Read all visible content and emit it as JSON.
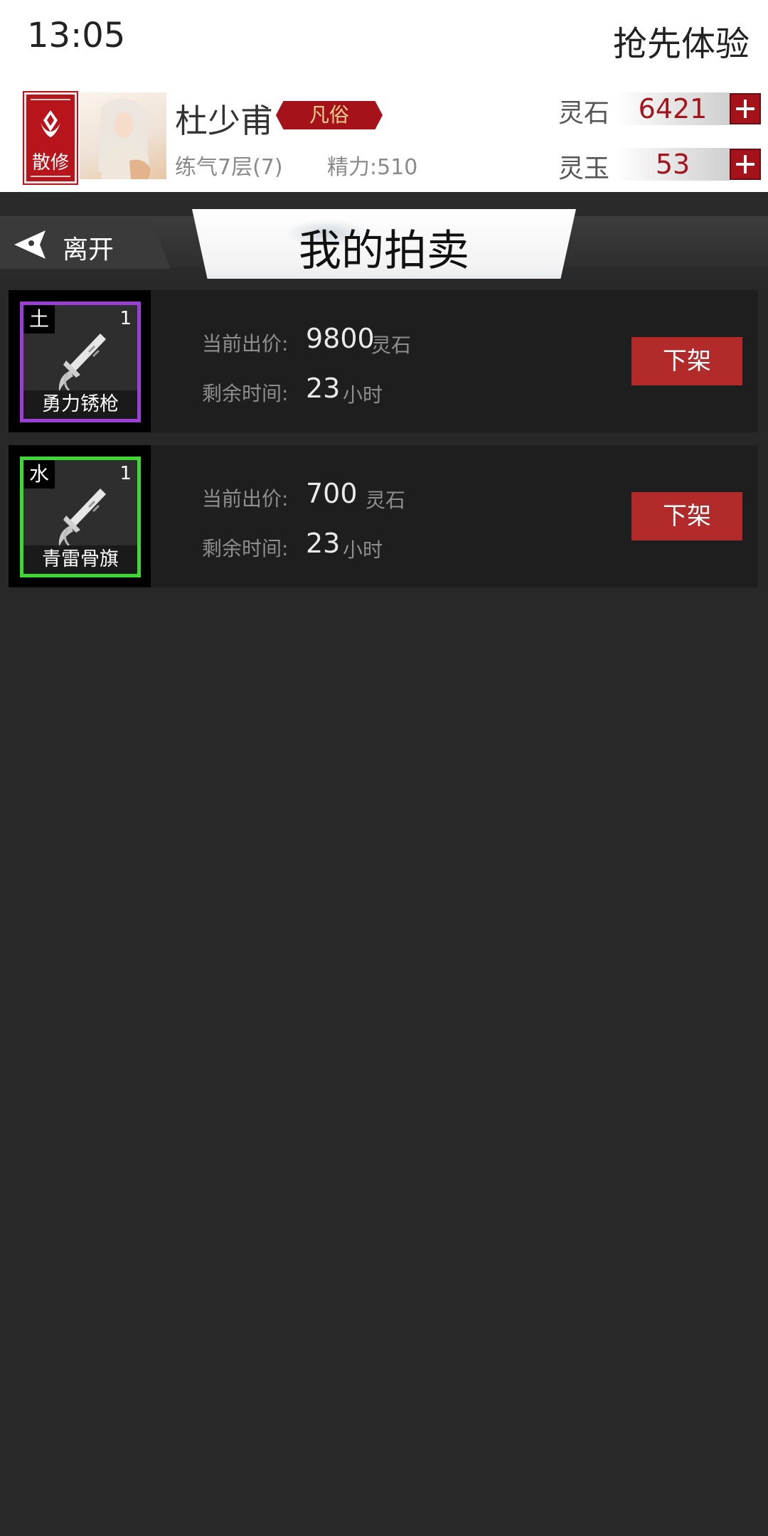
{
  "status": {
    "time": "13:05",
    "early_access": "抢先体验"
  },
  "player": {
    "sect": "散修",
    "name": "杜少甫",
    "rank": "凡俗",
    "realm": "练气7层(7)",
    "energy": "精力:510"
  },
  "currencies": [
    {
      "label": "灵石",
      "value": "6421"
    },
    {
      "label": "灵玉",
      "value": "53"
    }
  ],
  "nav": {
    "leave": "离开",
    "title": "我的拍卖"
  },
  "labels": {
    "current_bid": "当前出价:",
    "time_left": "剩余时间:",
    "hours": "小时",
    "delist": "下架"
  },
  "listings": [
    {
      "element": "土",
      "qty": "1",
      "name": "勇力锈枪",
      "bid": "9800",
      "bid_unit": "灵石",
      "time": "23",
      "frame_color": "#9b3fd6"
    },
    {
      "element": "水",
      "qty": "1",
      "name": "青雷骨旗",
      "bid": "700",
      "bid_unit": "灵石",
      "time": "23",
      "frame_color": "#3ed832"
    }
  ]
}
